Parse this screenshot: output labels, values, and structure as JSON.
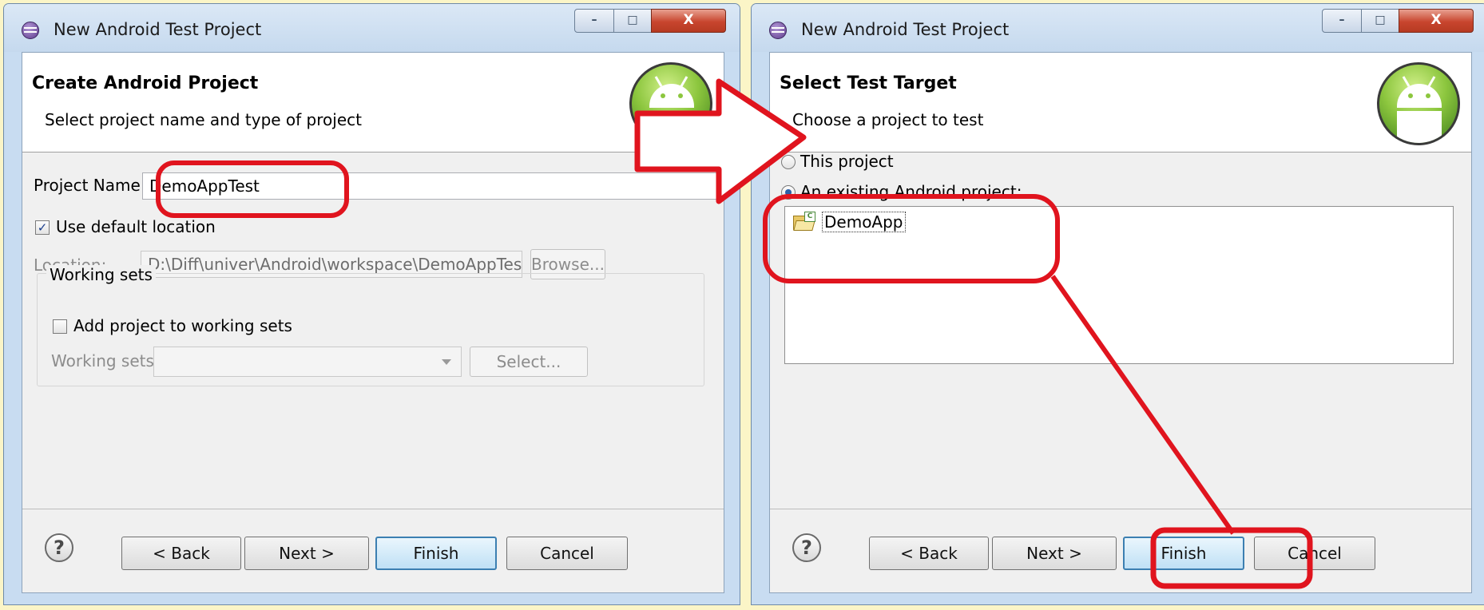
{
  "left_dialog": {
    "title": "New Android Test Project",
    "header_title": "Create Android Project",
    "header_subtitle": "Select project name and type of project",
    "project_name_label": "Project Name",
    "project_name_value": "DemoAppTest",
    "use_default_location_label": "Use default location",
    "use_default_location_checked": true,
    "location_label": "Location:",
    "location_value": "D:\\Diff\\univer\\Android\\workspace\\DemoAppTest",
    "browse_label": "Browse...",
    "working_sets_group_label": "Working sets",
    "add_to_working_sets_label": "Add project to working sets",
    "add_to_working_sets_checked": false,
    "working_sets_label": "Working sets:",
    "select_label": "Select...",
    "help_label": "?",
    "back_label": "< Back",
    "next_label": "Next >",
    "finish_label": "Finish",
    "cancel_label": "Cancel"
  },
  "right_dialog": {
    "title": "New Android Test Project",
    "header_title": "Select Test Target",
    "header_subtitle": "Choose a project to test",
    "this_project_label": "This project",
    "existing_project_label": "An existing Android project:",
    "selected_option": "existing",
    "projects": [
      "DemoApp"
    ],
    "help_label": "?",
    "back_label": "< Back",
    "next_label": "Next >",
    "finish_label": "Finish",
    "cancel_label": "Cancel"
  },
  "window_controls": {
    "minimize": "–",
    "maximize": "□",
    "close": "X"
  },
  "colors": {
    "annotation": "#e0141e",
    "background": "#fbf5c7",
    "titlebar": "#c8dcf1"
  }
}
